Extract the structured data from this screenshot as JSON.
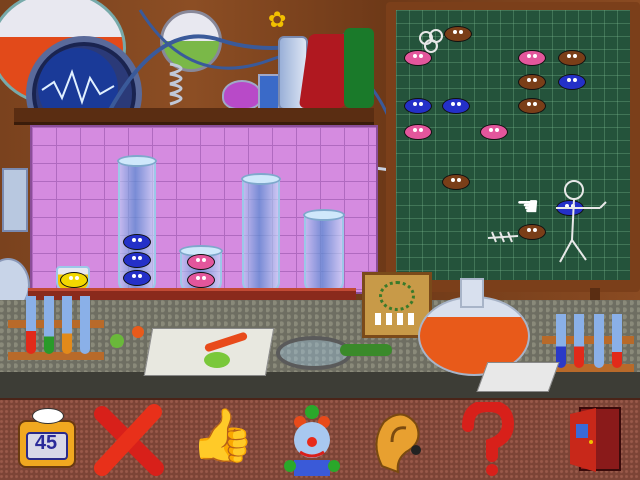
{
  "game": {
    "counter_value": "45"
  },
  "colors": {
    "pink_bean": "#e3569c",
    "blue_bean": "#2430c8",
    "brown_bean": "#7a3e18",
    "blackboard": "#24533b",
    "toolbar": "#7c4436"
  },
  "toolbar": {
    "items": [
      {
        "name": "counter-character",
        "icon": "number-counter-icon"
      },
      {
        "name": "erase-x",
        "icon": "red-x-icon"
      },
      {
        "name": "thumbs-up",
        "icon": "thumbs-up-icon"
      },
      {
        "name": "clown",
        "icon": "clown-icon"
      },
      {
        "name": "ear",
        "icon": "ear-icon"
      },
      {
        "name": "help",
        "icon": "question-mark-icon"
      },
      {
        "name": "exit",
        "icon": "exit-door-icon"
      }
    ]
  }
}
